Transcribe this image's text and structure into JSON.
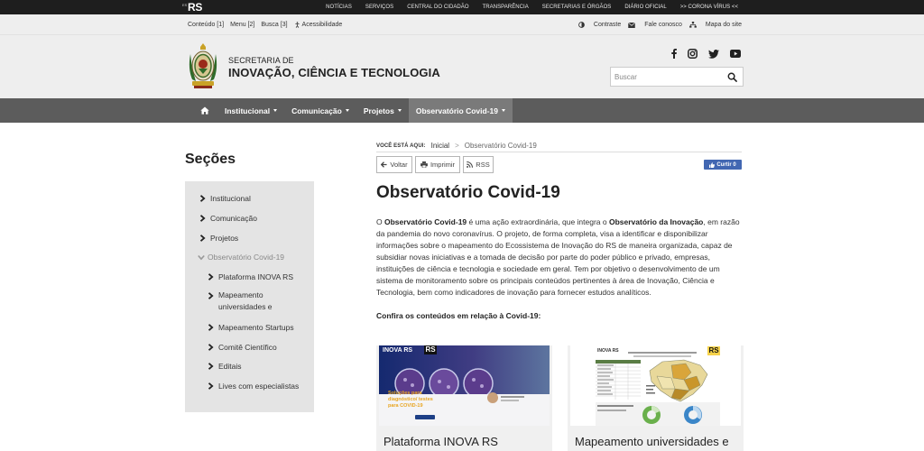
{
  "topbar": {
    "logo_small": "ESTADO",
    "logo_text": "RS",
    "links": [
      "NOTÍCIAS",
      "SERVIÇOS",
      "CENTRAL DO CIDADÃO",
      "TRANSPARÊNCIA",
      "SECRETARIAS E ÓRGÃOS",
      "DIÁRIO OFICIAL",
      ">> CORONA VÍRUS <<"
    ]
  },
  "utility": {
    "conteudo": "Conteúdo [1]",
    "menu": "Menu [2]",
    "busca": "Busca [3]",
    "acessibilidade": "Acessibilidade",
    "contraste": "Contraste",
    "fale_conosco": "Fale conosco",
    "mapa_site": "Mapa do site"
  },
  "header": {
    "line1": "SECRETARIA DE",
    "line2": "INOVAÇÃO, CIÊNCIA E TECNOLOGIA",
    "social_icons": [
      "facebook-icon",
      "instagram-icon",
      "twitter-icon",
      "youtube-icon"
    ],
    "search_placeholder": "Buscar"
  },
  "nav": {
    "items": [
      {
        "label": "Institucional"
      },
      {
        "label": "Comunicação"
      },
      {
        "label": "Projetos"
      },
      {
        "label": "Observatório Covid-19"
      }
    ]
  },
  "sidebar": {
    "title": "Seções",
    "items": [
      {
        "label": "Institucional"
      },
      {
        "label": "Comunicação"
      },
      {
        "label": "Projetos"
      },
      {
        "label": "Observatório Covid-19"
      },
      {
        "label": "Plataforma INOVA RS"
      },
      {
        "label": "Mapeamento universidades e"
      },
      {
        "label": "Mapeamento Startups"
      },
      {
        "label": "Comitê Científico"
      },
      {
        "label": "Editais"
      },
      {
        "label": "Lives com especialistas"
      }
    ]
  },
  "breadcrumb": {
    "label": "VOCÊ ESTÁ AQUI:",
    "home": "Inicial",
    "separator": ">",
    "current": "Observatório Covid-19"
  },
  "actions": {
    "voltar": "Voltar",
    "imprimir": "Imprimir",
    "rss": "RSS",
    "like": "Curtir 0"
  },
  "content": {
    "title": "Observatório Covid-19",
    "p_start": "O ",
    "p_bold1": "Observatório Covid-19",
    "p_mid": " é uma ação extraordinária, que integra o ",
    "p_bold2": "Observatório da Inovação",
    "p_rest": ", em razão da pandemia do novo coronavírus. O projeto, de forma completa, visa a identificar e disponibilizar informações sobre o mapeamento do Ecossistema de Inovação do RS de maneira organizada, capaz de subsidiar novas iniciativas e a tomada de decisão por parte do poder público e privado, empresas, instituições de ciência e tecnologia e sociedade em geral. Tem por objetivo o desenvolvimento de um sistema de monitoramento sobre os principais conteúdos pertinentes à área de Inovação, Ciência e Tecnologia, bem como indicadores de inovação para fornecer estudos analíticos.",
    "confira": "Confira os conteúdos em relação à Covid-19:"
  },
  "cards": [
    {
      "title": "Plataforma INOVA RS",
      "thumb_brand": "INOVA RS",
      "thumb_caption": "Soluções para diagnóstico/ testes para COVID-19"
    },
    {
      "title": "Mapeamento universidades e",
      "thumb_brand": "INOVA RS"
    }
  ]
}
